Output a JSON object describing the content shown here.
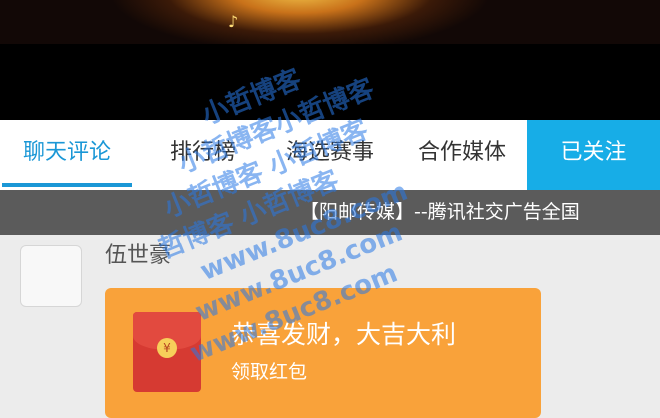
{
  "hero": {
    "image_icon": "music-note-sparkle-icon"
  },
  "tabs": [
    {
      "label": "聊天评论",
      "active": true
    },
    {
      "label": "排行榜",
      "active": false
    },
    {
      "label": "海选赛事",
      "active": false
    },
    {
      "label": "合作媒体",
      "active": false
    }
  ],
  "follow_label": "已关注",
  "marquee_text": "【阳邮传媒】--腾讯社交广告全国",
  "message": {
    "sender": "伍世豪",
    "red_packet": {
      "title": "恭喜发财，大吉大利",
      "subtitle": "领取红包",
      "coin_glyph": "¥"
    }
  },
  "watermark": {
    "lines": [
      "小哲博客",
      "小哲博客小哲博客",
      "小哲博客 小哲博客",
      "哲博客 小哲博客",
      "www.8uc8.com",
      "www.8uc8.com",
      "www.8uc8.com"
    ]
  },
  "colors": {
    "accent": "#1a97d6",
    "follow_bg": "#17ade7",
    "card": "#f9a23a",
    "envelope": "#d63a32"
  }
}
